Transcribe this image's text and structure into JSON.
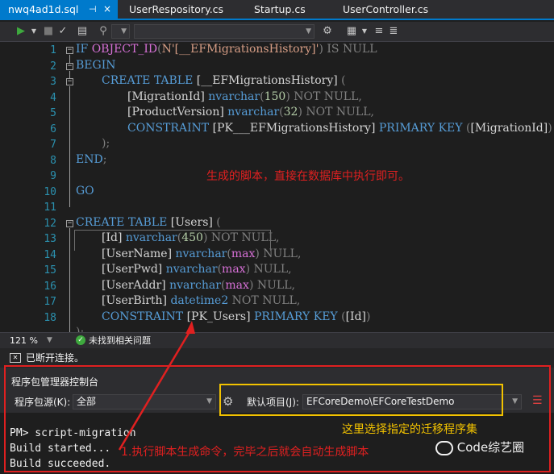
{
  "tabs": [
    {
      "label": "nwq4ad1d.sql",
      "pin": "⊣"
    },
    {
      "label": "UserRespository.cs"
    },
    {
      "label": "Startup.cs"
    },
    {
      "label": "UserController.cs"
    }
  ],
  "line_numbers": [
    "1",
    "2",
    "3",
    "4",
    "5",
    "6",
    "7",
    "8",
    "9",
    "10",
    "11",
    "12",
    "13",
    "14",
    "15",
    "16",
    "17",
    "18"
  ],
  "code": {
    "l1": {
      "kw1": "IF ",
      "fn": "OBJECT_ID",
      "p1": "(",
      "str": "N'[__EFMigrationsHistory]'",
      "p2": ")",
      "kw2": " IS NULL"
    },
    "l2": {
      "kw": "BEGIN"
    },
    "l3": {
      "kw": "CREATE TABLE ",
      "id": "[__EFMigrationsHistory] ",
      "p": "("
    },
    "l4": {
      "id": "[MigrationId] ",
      "kw": "nvarchar",
      "p1": "(",
      "n": "150",
      "p2": ")",
      "k2": " NOT NULL",
      "p3": ","
    },
    "l5": {
      "id": "[ProductVersion] ",
      "kw": "nvarchar",
      "p1": "(",
      "n": "32",
      "p2": ")",
      "k2": " NOT NULL",
      "p3": ","
    },
    "l6": {
      "kw": "CONSTRAINT ",
      "id": "[PK___EFMigrationsHistory] ",
      "k2": "PRIMARY KEY ",
      "p1": "(",
      "id2": "[MigrationId]",
      "p2": ")"
    },
    "l7": {
      "p": ");"
    },
    "l8": {
      "kw": "END",
      "p": ";"
    },
    "l10": {
      "kw": "GO"
    },
    "l12": {
      "kw": "CREATE TABLE ",
      "id": "[Users] ",
      "p": "("
    },
    "l13": {
      "id": "[Id] ",
      "kw": "nvarchar",
      "p1": "(",
      "n": "450",
      "p2": ")",
      "k2": " NOT NULL",
      "p3": ","
    },
    "l14": {
      "id": "[UserName] ",
      "kw": "nvarchar",
      "p1": "(",
      "n": "max",
      "p2": ")",
      "k2": " NULL",
      "p3": ","
    },
    "l15": {
      "id": "[UserPwd] ",
      "kw": "nvarchar",
      "p1": "(",
      "n": "max",
      "p2": ")",
      "k2": " NULL",
      "p3": ","
    },
    "l16": {
      "id": "[UserAddr] ",
      "kw": "nvarchar",
      "p1": "(",
      "n": "max",
      "p2": ")",
      "k2": " NULL",
      "p3": ","
    },
    "l17": {
      "id": "[UserBirth] ",
      "kw": "datetime2",
      "k2": " NOT NULL",
      "p3": ","
    },
    "l18": {
      "kw": "CONSTRAINT ",
      "id": "[PK_Users] ",
      "k2": "PRIMARY KEY ",
      "p1": "(",
      "id2": "[Id]",
      "p2": ")"
    },
    "l19": {
      "p": ");"
    }
  },
  "annotations": {
    "script_note": "生成的脚本，直接在数据库中执行即可。",
    "select_note": "这里选择指定的迁移程序集",
    "command_note": "1.执行脚本生成命令，完毕之后就会自动生成脚本"
  },
  "editor_status": {
    "zoom": "121 %",
    "issues": "未找到相关问题"
  },
  "connection_status": "已断开连接。",
  "pmc": {
    "title": "程序包管理器控制台",
    "source_label": "程序包源(K):",
    "source_value": "全部",
    "project_label": "默认项目(J):",
    "project_value": "EFCoreDemo\\EFCoreTestDemo",
    "console": [
      "PM> script-migration",
      "Build started...",
      "Build succeeded."
    ]
  },
  "watermark": "Code综艺圈",
  "colors": {
    "accent": "#007acc",
    "annotation_red": "#e02020",
    "highlight_yellow": "#f2c200"
  }
}
